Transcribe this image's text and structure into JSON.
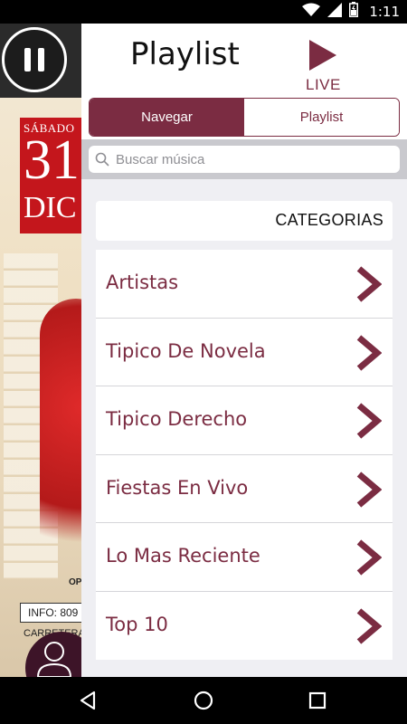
{
  "status_bar": {
    "time": "1:11",
    "icons": [
      "wifi-icon",
      "signal-icon",
      "battery-icon"
    ]
  },
  "player": {
    "pause_icon": "pause-icon",
    "avatar_icon": "user-icon"
  },
  "poster": {
    "weekday": "SÁBADO",
    "day": "31",
    "month": "DIC",
    "ope_text": "OPE",
    "info_text": "INFO: 809",
    "carretera_text": "CARRETERA"
  },
  "drawer": {
    "title": "Playlist",
    "live_label": "LIVE",
    "tabs": [
      {
        "label": "Navegar",
        "active": true
      },
      {
        "label": "Playlist",
        "active": false
      }
    ],
    "search": {
      "placeholder": "Buscar música",
      "value": ""
    },
    "categories_header": "CATEGORIAS",
    "categories": [
      {
        "label": "Artistas"
      },
      {
        "label": "Tipico De Novela"
      },
      {
        "label": "Tipico Derecho"
      },
      {
        "label": "Fiestas En Vivo"
      },
      {
        "label": "Lo Mas Reciente"
      },
      {
        "label": "Top 10"
      }
    ]
  },
  "nav_bar": {
    "buttons": [
      "back-icon",
      "home-icon",
      "recents-icon"
    ]
  },
  "colors": {
    "accent": "#7b2c42",
    "background": "#efeff3"
  }
}
